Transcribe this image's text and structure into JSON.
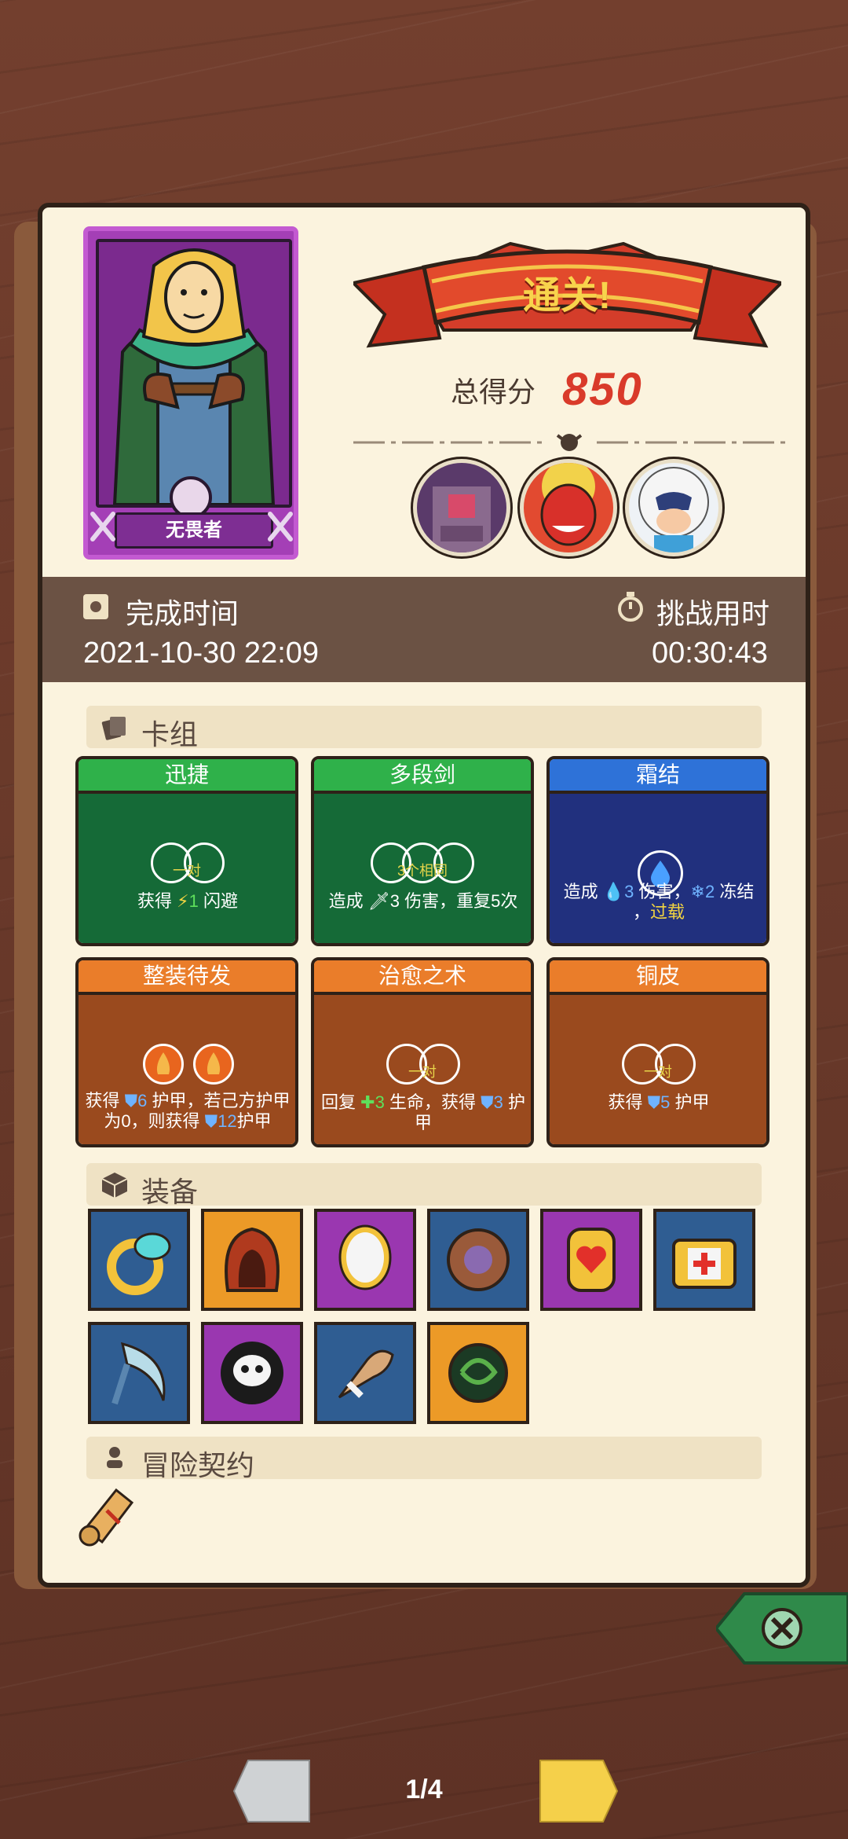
{
  "hero": {
    "name": "无畏者"
  },
  "result": {
    "title": "通关!",
    "score_label": "总得分",
    "score": "850"
  },
  "bosses": [
    {
      "icon": "stone-golem-boss-icon"
    },
    {
      "icon": "red-demon-boss-icon"
    },
    {
      "icon": "yeti-boss-icon"
    }
  ],
  "times": {
    "finish_label": "完成时间",
    "finish_value": "2021-10-30 22:09",
    "challenge_label": "挑战用时",
    "challenge_value": "00:30:43"
  },
  "sections": {
    "deck": "卡组",
    "equipment": "装备",
    "contract": "冒险契约"
  },
  "cards": [
    {
      "name": "迅捷",
      "color": "green",
      "requirement": "一对",
      "desc_a": "获得 ",
      "num": "1",
      "desc_b": " 闪避"
    },
    {
      "name": "多段剑",
      "color": "green",
      "requirement": "3个相同",
      "desc_a": "造成 ",
      "num": "3",
      "desc_b": " 伤害，重复5次"
    },
    {
      "name": "霜结",
      "color": "blue",
      "requirement": "",
      "desc_a": "造成 ",
      "num": "3",
      "desc_b": " 伤害，",
      "num2": "2",
      "desc_c": " 冻结",
      "desc_d": "，",
      "overload": "过载"
    },
    {
      "name": "整装待发",
      "color": "orange",
      "requirement": "",
      "desc_a": "获得 ",
      "num": "6",
      "desc_b": " 护甲，若己方护甲为0，则获得 ",
      "num2": "12",
      "desc_c": "护甲"
    },
    {
      "name": "治愈之术",
      "color": "orange",
      "requirement": "一对",
      "desc_a": "回复 ",
      "num": "3",
      "desc_b": " 生命，获得 ",
      "num2": "3",
      "desc_c": " 护甲"
    },
    {
      "name": "铜皮",
      "color": "orange",
      "requirement": "一对",
      "desc_a": "获得 ",
      "num": "5",
      "desc_b": " 护甲"
    }
  ],
  "equipment": [
    {
      "icon": "ring-icon",
      "bg": "blue"
    },
    {
      "icon": "hood-icon",
      "bg": "orange"
    },
    {
      "icon": "mirror-icon",
      "bg": "purple"
    },
    {
      "icon": "shield-icon",
      "bg": "blue"
    },
    {
      "icon": "heart-charm-icon",
      "bg": "purple"
    },
    {
      "icon": "medkit-icon",
      "bg": "blue"
    },
    {
      "icon": "scythe-icon",
      "bg": "blue"
    },
    {
      "icon": "cursed-skull-icon",
      "bg": "purple"
    },
    {
      "icon": "horn-icon",
      "bg": "blue"
    },
    {
      "icon": "seed-icon",
      "bg": "orange"
    }
  ],
  "pager": "1/4",
  "colors": {
    "score_red": "#d93a2a",
    "panel": "#fbf3de",
    "time_bar": "#6b5244"
  }
}
